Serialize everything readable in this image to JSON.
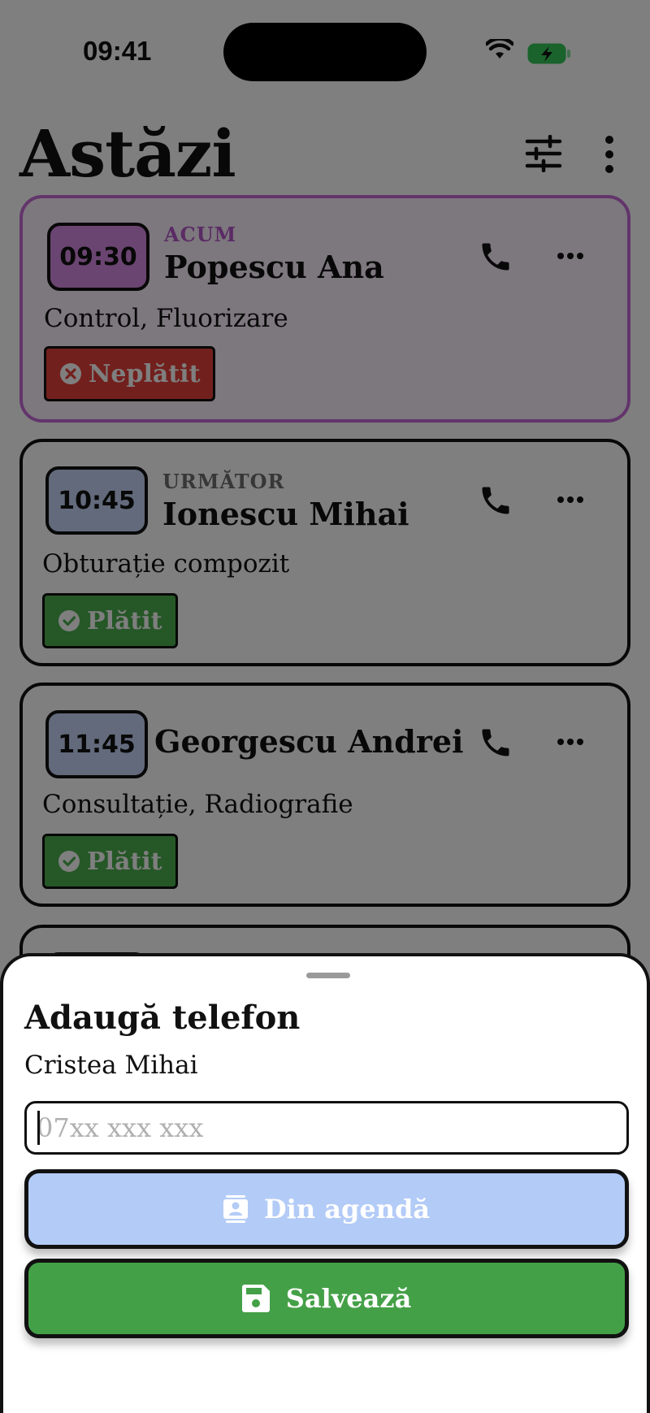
{
  "status_bar": {
    "time": "09:41"
  },
  "header": {
    "title": "Astăzi"
  },
  "appointments": [
    {
      "time": "09:30",
      "tag": "ACUM",
      "name": "Popescu Ana",
      "procedure": "Control, Fluorizare",
      "payment": "Neplătit",
      "payment_status": "unpaid",
      "color": "#d68be3"
    },
    {
      "time": "10:45",
      "tag": "URMĂTOR",
      "name": "Ionescu Mihai",
      "procedure": "Obturație compozit",
      "payment": "Plătit",
      "payment_status": "paid",
      "color": "#c4d4f6"
    },
    {
      "time": "11:45",
      "tag": "",
      "name": "Georgescu Andrei",
      "procedure": "Consultație, Radiografie",
      "payment": "Plătit",
      "payment_status": "paid",
      "color": "#c4d4f6"
    }
  ],
  "sheet": {
    "title": "Adaugă telefon",
    "subtitle": "Cristea Mihai",
    "phone_placeholder": "07xx xxx xxx",
    "phone_value": "",
    "agenda_label": "Din agendă",
    "save_label": "Salvează"
  },
  "colors": {
    "now_accent": "#c56ad6",
    "unpaid": "#e5403a",
    "paid": "#4cae4f",
    "save_button": "#44a047",
    "agenda_button": "#b3cbf7"
  },
  "icons": [
    "wifi-icon",
    "battery-charging-icon",
    "tune-icon",
    "more-vert-icon",
    "phone-icon",
    "more-horiz-icon",
    "cancel-icon",
    "check-circle-icon",
    "contact-icon",
    "save-icon"
  ]
}
